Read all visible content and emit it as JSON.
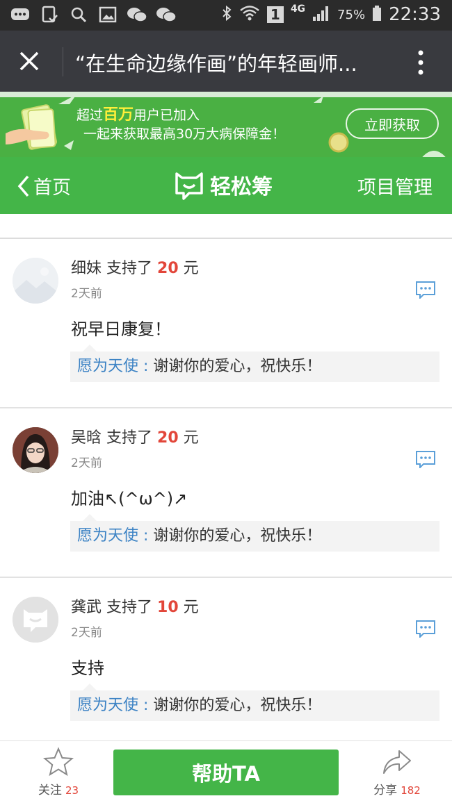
{
  "status_bar": {
    "signal_label": "4G",
    "sim_slot": "1",
    "battery": "75%",
    "time": "22:33"
  },
  "title_bar": {
    "title": "“在生命边缘作画”的年轻画师..."
  },
  "banner": {
    "prefix": "超过",
    "highlight": "百万",
    "suffix": "用户已加入",
    "line2": "一起来获取最高30万大病保障金！",
    "button": "立即获取"
  },
  "nav": {
    "back_label": "首页",
    "logo_text": "轻松筹",
    "manage_label": "项目管理"
  },
  "comments": [
    {
      "name": "细妹",
      "action": "支持了",
      "amount": "20",
      "unit": "元",
      "time": "2天前",
      "message": "祝早日康复！",
      "reply_who": "愿为天使 :",
      "reply_text": "谢谢你的爱心，祝快乐！"
    },
    {
      "name": "吴晗",
      "action": "支持了",
      "amount": "20",
      "unit": "元",
      "time": "2天前",
      "message": "加油↖(^ω^)↗",
      "reply_who": "愿为天使 :",
      "reply_text": "谢谢你的爱心，祝快乐！"
    },
    {
      "name": "龚武",
      "action": "支持了",
      "amount": "10",
      "unit": "元",
      "time": "2天前",
      "message": "支持",
      "reply_who": "愿为天使 :",
      "reply_text": "谢谢你的爱心，祝快乐！"
    }
  ],
  "bottom_bar": {
    "follow_label": "关注",
    "follow_count": "23",
    "help_button": "帮助TA",
    "share_label": "分享",
    "share_count": "182"
  },
  "colors": {
    "brand_green": "#44b548",
    "amount_red": "#e2463a",
    "reply_blue": "#3b82c4",
    "titlebar_bg": "#393a3f"
  }
}
